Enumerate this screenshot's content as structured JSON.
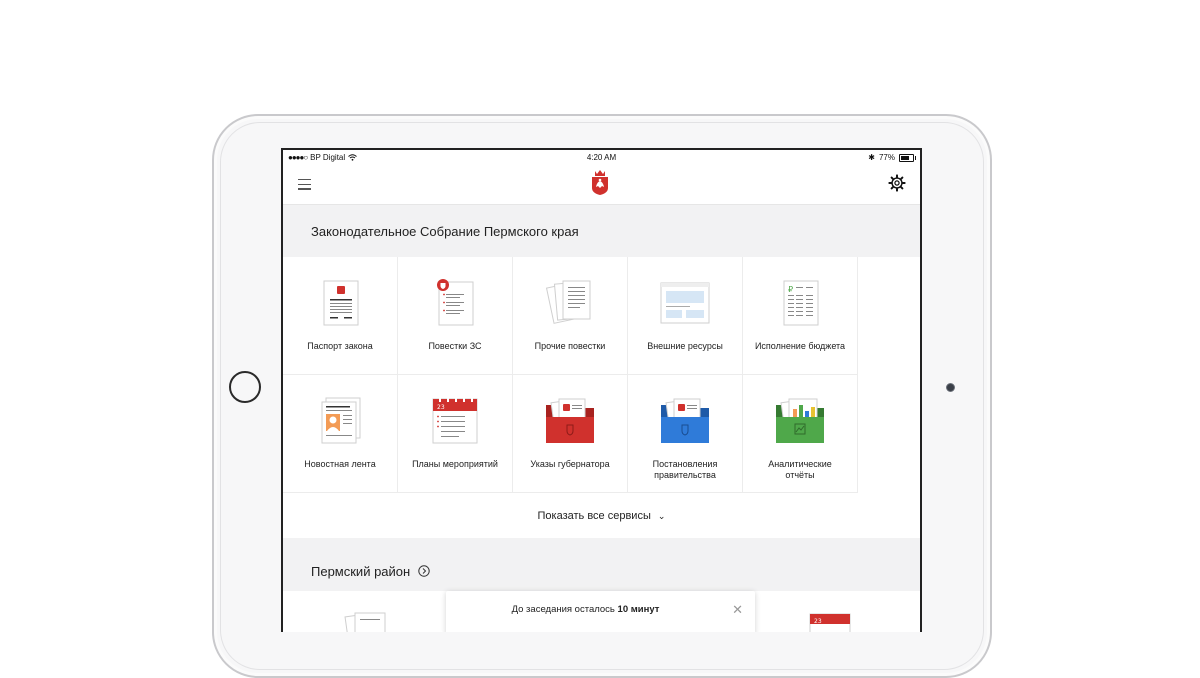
{
  "status_bar": {
    "carrier": "BP Digital",
    "time": "4:20 AM",
    "battery": "77%"
  },
  "nav": {
    "menu_icon": "hamburger-icon",
    "logo_icon": "perm-crest-icon",
    "settings_icon": "gear-icon"
  },
  "section1": {
    "title": "Законодательное Собрание Пермского края",
    "tiles": [
      {
        "label": "Паспорт закона",
        "icon": "document-icon"
      },
      {
        "label": "Повестки ЗС",
        "icon": "agenda-document-icon"
      },
      {
        "label": "Прочие повестки",
        "icon": "documents-stack-icon"
      },
      {
        "label": "Внешние ресурсы",
        "icon": "browser-window-icon"
      },
      {
        "label": "Исполнение бюджета",
        "icon": "budget-document-icon"
      },
      {
        "label": "Новостная лента",
        "icon": "news-icon"
      },
      {
        "label": "Планы мероприятий",
        "icon": "calendar-icon",
        "calendar_day": "23"
      },
      {
        "label": "Указы губернатора",
        "icon": "red-folder-icon"
      },
      {
        "label": "Постановления\nправительства",
        "icon": "blue-folder-icon"
      },
      {
        "label": "Аналитические\nотчёты",
        "icon": "green-folder-chart-icon"
      }
    ],
    "show_all": "Показать все сервисы"
  },
  "section2": {
    "title": "Пермский район"
  },
  "toast": {
    "text_prefix": "До заседания осталось ",
    "text_bold": "10 минут"
  },
  "colors": {
    "accent_red": "#d0312d",
    "folder_blue": "#2f7bd9",
    "folder_green": "#4fa84a",
    "section_bg": "#f2f2f3"
  }
}
